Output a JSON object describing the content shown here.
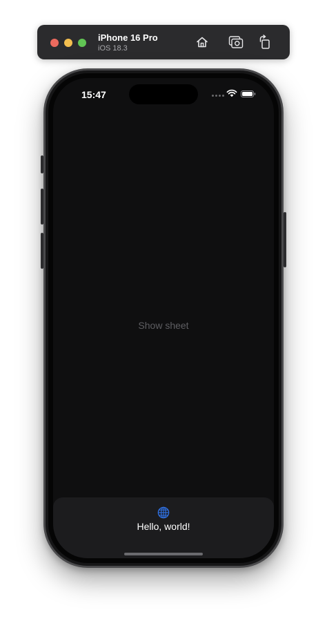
{
  "simulator": {
    "device_name": "iPhone 16 Pro",
    "os_version": "iOS 18.3",
    "buttons": {
      "home_icon": "home-icon",
      "screenshot_icon": "screenshot-icon",
      "rotate_icon": "rotate-icon"
    },
    "traffic_light_colors": {
      "close": "#ec6a5e",
      "minimize": "#f4bf4f",
      "zoom": "#61c554"
    }
  },
  "status_bar": {
    "time": "15:47",
    "icons": [
      "cellular-icon",
      "wifi-icon",
      "battery-icon"
    ]
  },
  "app": {
    "show_sheet_label": "Show sheet",
    "sheet": {
      "icon": "globe-icon",
      "icon_color": "#2f6fe0",
      "text": "Hello, world!"
    }
  }
}
